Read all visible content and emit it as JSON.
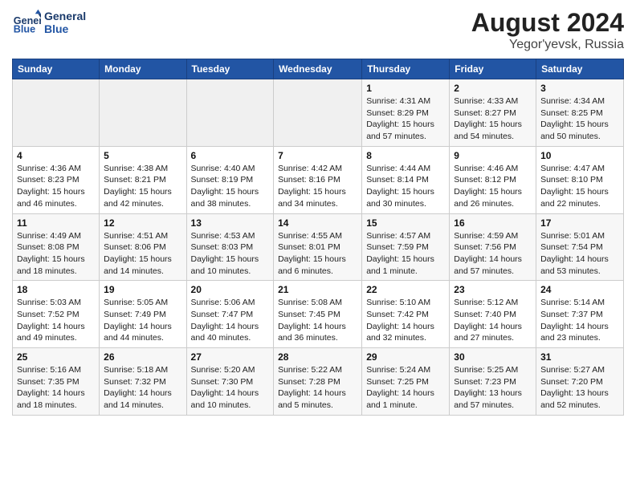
{
  "header": {
    "logo_line1": "General",
    "logo_line2": "Blue",
    "title": "August 2024",
    "subtitle": "Yegor'yevsk, Russia"
  },
  "weekdays": [
    "Sunday",
    "Monday",
    "Tuesday",
    "Wednesday",
    "Thursday",
    "Friday",
    "Saturday"
  ],
  "weeks": [
    [
      {
        "day": "",
        "info": ""
      },
      {
        "day": "",
        "info": ""
      },
      {
        "day": "",
        "info": ""
      },
      {
        "day": "",
        "info": ""
      },
      {
        "day": "1",
        "info": "Sunrise: 4:31 AM\nSunset: 8:29 PM\nDaylight: 15 hours\nand 57 minutes."
      },
      {
        "day": "2",
        "info": "Sunrise: 4:33 AM\nSunset: 8:27 PM\nDaylight: 15 hours\nand 54 minutes."
      },
      {
        "day": "3",
        "info": "Sunrise: 4:34 AM\nSunset: 8:25 PM\nDaylight: 15 hours\nand 50 minutes."
      }
    ],
    [
      {
        "day": "4",
        "info": "Sunrise: 4:36 AM\nSunset: 8:23 PM\nDaylight: 15 hours\nand 46 minutes."
      },
      {
        "day": "5",
        "info": "Sunrise: 4:38 AM\nSunset: 8:21 PM\nDaylight: 15 hours\nand 42 minutes."
      },
      {
        "day": "6",
        "info": "Sunrise: 4:40 AM\nSunset: 8:19 PM\nDaylight: 15 hours\nand 38 minutes."
      },
      {
        "day": "7",
        "info": "Sunrise: 4:42 AM\nSunset: 8:16 PM\nDaylight: 15 hours\nand 34 minutes."
      },
      {
        "day": "8",
        "info": "Sunrise: 4:44 AM\nSunset: 8:14 PM\nDaylight: 15 hours\nand 30 minutes."
      },
      {
        "day": "9",
        "info": "Sunrise: 4:46 AM\nSunset: 8:12 PM\nDaylight: 15 hours\nand 26 minutes."
      },
      {
        "day": "10",
        "info": "Sunrise: 4:47 AM\nSunset: 8:10 PM\nDaylight: 15 hours\nand 22 minutes."
      }
    ],
    [
      {
        "day": "11",
        "info": "Sunrise: 4:49 AM\nSunset: 8:08 PM\nDaylight: 15 hours\nand 18 minutes."
      },
      {
        "day": "12",
        "info": "Sunrise: 4:51 AM\nSunset: 8:06 PM\nDaylight: 15 hours\nand 14 minutes."
      },
      {
        "day": "13",
        "info": "Sunrise: 4:53 AM\nSunset: 8:03 PM\nDaylight: 15 hours\nand 10 minutes."
      },
      {
        "day": "14",
        "info": "Sunrise: 4:55 AM\nSunset: 8:01 PM\nDaylight: 15 hours\nand 6 minutes."
      },
      {
        "day": "15",
        "info": "Sunrise: 4:57 AM\nSunset: 7:59 PM\nDaylight: 15 hours\nand 1 minute."
      },
      {
        "day": "16",
        "info": "Sunrise: 4:59 AM\nSunset: 7:56 PM\nDaylight: 14 hours\nand 57 minutes."
      },
      {
        "day": "17",
        "info": "Sunrise: 5:01 AM\nSunset: 7:54 PM\nDaylight: 14 hours\nand 53 minutes."
      }
    ],
    [
      {
        "day": "18",
        "info": "Sunrise: 5:03 AM\nSunset: 7:52 PM\nDaylight: 14 hours\nand 49 minutes."
      },
      {
        "day": "19",
        "info": "Sunrise: 5:05 AM\nSunset: 7:49 PM\nDaylight: 14 hours\nand 44 minutes."
      },
      {
        "day": "20",
        "info": "Sunrise: 5:06 AM\nSunset: 7:47 PM\nDaylight: 14 hours\nand 40 minutes."
      },
      {
        "day": "21",
        "info": "Sunrise: 5:08 AM\nSunset: 7:45 PM\nDaylight: 14 hours\nand 36 minutes."
      },
      {
        "day": "22",
        "info": "Sunrise: 5:10 AM\nSunset: 7:42 PM\nDaylight: 14 hours\nand 32 minutes."
      },
      {
        "day": "23",
        "info": "Sunrise: 5:12 AM\nSunset: 7:40 PM\nDaylight: 14 hours\nand 27 minutes."
      },
      {
        "day": "24",
        "info": "Sunrise: 5:14 AM\nSunset: 7:37 PM\nDaylight: 14 hours\nand 23 minutes."
      }
    ],
    [
      {
        "day": "25",
        "info": "Sunrise: 5:16 AM\nSunset: 7:35 PM\nDaylight: 14 hours\nand 18 minutes."
      },
      {
        "day": "26",
        "info": "Sunrise: 5:18 AM\nSunset: 7:32 PM\nDaylight: 14 hours\nand 14 minutes."
      },
      {
        "day": "27",
        "info": "Sunrise: 5:20 AM\nSunset: 7:30 PM\nDaylight: 14 hours\nand 10 minutes."
      },
      {
        "day": "28",
        "info": "Sunrise: 5:22 AM\nSunset: 7:28 PM\nDaylight: 14 hours\nand 5 minutes."
      },
      {
        "day": "29",
        "info": "Sunrise: 5:24 AM\nSunset: 7:25 PM\nDaylight: 14 hours\nand 1 minute."
      },
      {
        "day": "30",
        "info": "Sunrise: 5:25 AM\nSunset: 7:23 PM\nDaylight: 13 hours\nand 57 minutes."
      },
      {
        "day": "31",
        "info": "Sunrise: 5:27 AM\nSunset: 7:20 PM\nDaylight: 13 hours\nand 52 minutes."
      }
    ]
  ]
}
